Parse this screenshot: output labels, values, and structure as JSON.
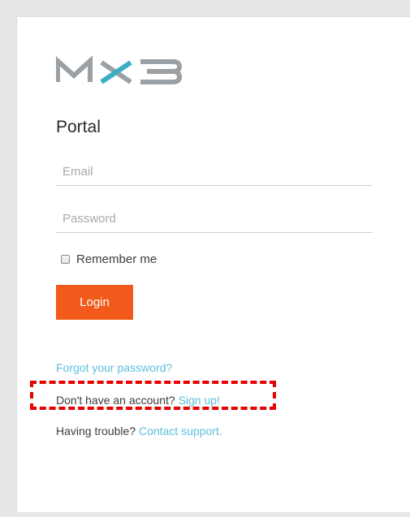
{
  "portal": {
    "logo_text": "MX3",
    "title": "Portal",
    "email_placeholder": "Email",
    "password_placeholder": "Password",
    "remember_label": "Remember me",
    "login_label": "Login",
    "forgot_link": "Forgot your password?",
    "no_account_text": "Don't have an account?",
    "signup_link": "Sign up!",
    "trouble_text": "Having trouble?",
    "support_link": "Contact support."
  },
  "colors": {
    "brand_gray": "#9aa0a4",
    "brand_teal": "#3aaec3",
    "button": "#f25a1b",
    "link": "#5bbfdc",
    "highlight": "#e60000"
  },
  "icons": {
    "logo": "mx3-logo",
    "checkbox": "checkbox-unchecked"
  }
}
